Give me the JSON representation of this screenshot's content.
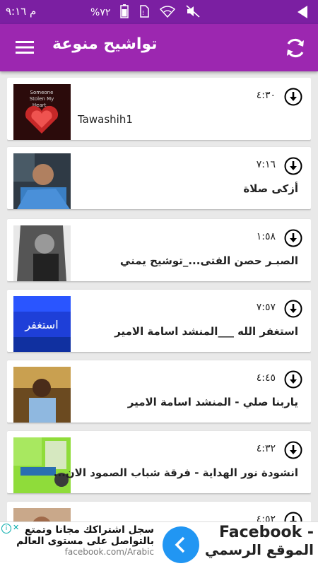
{
  "status_bar": {
    "time": "م ٩:١٦",
    "battery": "%٧٢"
  },
  "header": {
    "title": "تواشيح منوعة",
    "menu_icon": "hamburger-icon",
    "refresh_icon": "refresh-icon"
  },
  "items": [
    {
      "duration": "٤:٣٠",
      "title": "Tawashih1",
      "thumb_color": "#7a1b1b"
    },
    {
      "duration": "٧:١٦",
      "title": "أزكى صلاة",
      "thumb_color": "#3a4a5a"
    },
    {
      "duration": "١:٥٨",
      "title": "الصبـر حصن الفتى..._توشيح يمني",
      "thumb_color": "#555555"
    },
    {
      "duration": "٧:٥٧",
      "title": "استغفر الله ___المنشد اسامة الامير",
      "thumb_color": "#1e3fd8"
    },
    {
      "duration": "٤:٤٥",
      "title": "ياربنا صلي - المنشد اسامة الامير",
      "thumb_color": "#a07030"
    },
    {
      "duration": "٤:٣٢",
      "title": "انشودة نور الهداية - فرقة شباب الصمود الان...",
      "thumb_color": "#7fcf2f"
    },
    {
      "duration": "٤:٥٢",
      "title": "",
      "thumb_color": "#c9a88a"
    }
  ],
  "ad": {
    "brand_line1": "Facebook -",
    "brand_line2": "الموقع الرسمي",
    "line1": "سجل اشتراكك مجانا وتمتع",
    "line2": "بالتواصل على مستوى العالم",
    "url": "facebook.com/Arabic",
    "info_glyph": "i"
  }
}
